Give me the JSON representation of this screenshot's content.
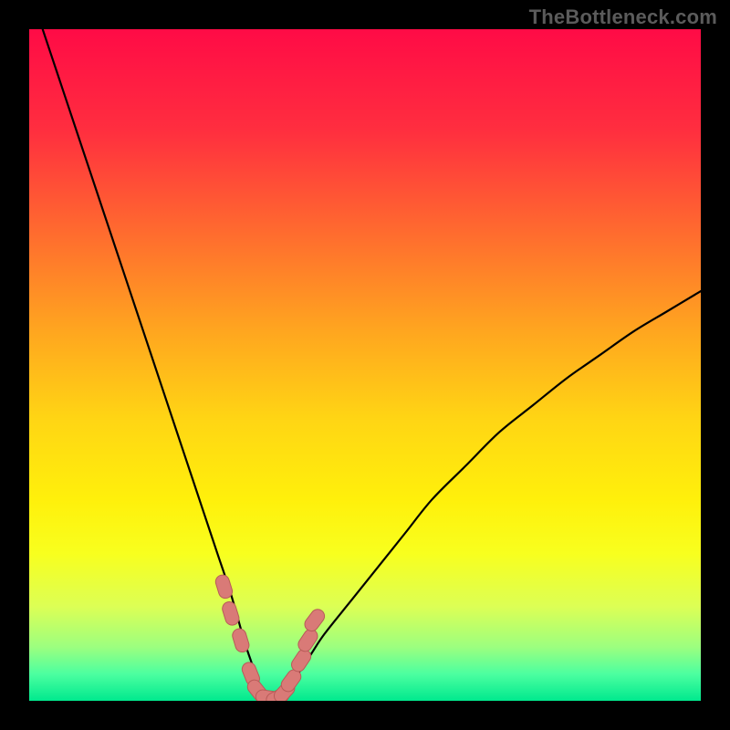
{
  "watermark": "TheBottleneck.com",
  "colors": {
    "gradient_stops": [
      {
        "offset": 0.0,
        "color": "#ff0b46"
      },
      {
        "offset": 0.15,
        "color": "#ff2e3f"
      },
      {
        "offset": 0.3,
        "color": "#ff6a2f"
      },
      {
        "offset": 0.45,
        "color": "#ffa61f"
      },
      {
        "offset": 0.58,
        "color": "#ffd514"
      },
      {
        "offset": 0.7,
        "color": "#fff00b"
      },
      {
        "offset": 0.78,
        "color": "#f8ff1e"
      },
      {
        "offset": 0.86,
        "color": "#dcff55"
      },
      {
        "offset": 0.92,
        "color": "#9cff7f"
      },
      {
        "offset": 0.96,
        "color": "#4cffa0"
      },
      {
        "offset": 1.0,
        "color": "#00e98e"
      }
    ],
    "curve": "#000000",
    "marker_fill": "#d97a77",
    "marker_stroke": "#b85b58",
    "frame": "#000000"
  },
  "chart_data": {
    "type": "line",
    "title": "",
    "xlabel": "",
    "ylabel": "",
    "xlim": [
      0,
      100
    ],
    "ylim": [
      0,
      100
    ],
    "grid": false,
    "legend": false,
    "series": [
      {
        "name": "bottleneck-curve",
        "x": [
          2,
          4,
          6,
          8,
          10,
          12,
          14,
          16,
          18,
          20,
          22,
          24,
          26,
          28,
          30,
          32,
          33,
          34,
          35,
          36,
          37,
          38,
          40,
          42,
          44,
          48,
          52,
          56,
          60,
          65,
          70,
          75,
          80,
          85,
          90,
          95,
          100
        ],
        "values": [
          100,
          94,
          88,
          82,
          76,
          70,
          64,
          58,
          52,
          46,
          40,
          34,
          28,
          22,
          16,
          9,
          6,
          3,
          1,
          0.5,
          0.7,
          1.5,
          4,
          7,
          10,
          15,
          20,
          25,
          30,
          35,
          40,
          44,
          48,
          51.5,
          55,
          58,
          61
        ]
      }
    ],
    "markers": [
      {
        "x": 29,
        "y": 17
      },
      {
        "x": 30,
        "y": 13
      },
      {
        "x": 31.5,
        "y": 9
      },
      {
        "x": 33,
        "y": 4
      },
      {
        "x": 34,
        "y": 1.5
      },
      {
        "x": 35.5,
        "y": 0.5
      },
      {
        "x": 37,
        "y": 0.5
      },
      {
        "x": 38,
        "y": 1.3
      },
      {
        "x": 39,
        "y": 3
      },
      {
        "x": 40.5,
        "y": 6
      },
      {
        "x": 41.5,
        "y": 9
      },
      {
        "x": 42.5,
        "y": 12
      }
    ],
    "annotations": []
  }
}
